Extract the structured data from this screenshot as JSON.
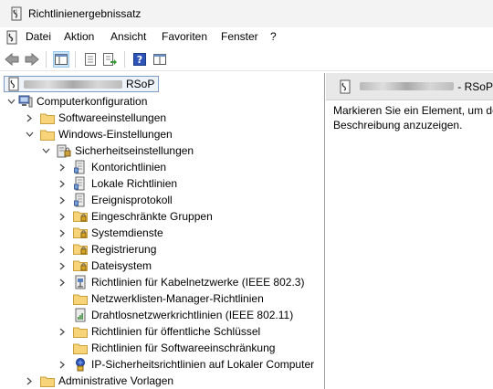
{
  "window": {
    "title": "Richtlinienergebnissatz"
  },
  "menu": {
    "items": [
      "Datei",
      "Aktion",
      "Ansicht",
      "Favoriten",
      "Fenster",
      "?"
    ]
  },
  "tree": {
    "root_suffix": "RSoP",
    "computer_config": "Computerkonfiguration",
    "software_settings": "Softwareeinstellungen",
    "windows_settings": "Windows-Einstellungen",
    "security_settings": "Sicherheitseinstellungen",
    "security_children": [
      "Kontorichtlinien",
      "Lokale Richtlinien",
      "Ereignisprotokoll",
      "Eingeschränkte Gruppen",
      "Systemdienste",
      "Registrierung",
      "Dateisystem",
      "Richtlinien für Kabelnetzwerke (IEEE 802.3)",
      "Netzwerklisten-Manager-Richtlinien",
      "Drahtlosnetzwerkrichtlinien (IEEE 802.11)",
      "Richtlinien für öffentliche Schlüssel",
      "Richtlinien für Softwareeinschränkung",
      "IP-Sicherheitsrichtlinien auf Lokaler Computer"
    ],
    "admin_templates": "Administrative Vorlagen"
  },
  "details": {
    "header_suffix": "- RSoP",
    "description": "Markieren Sie ein Element, um dessen Beschreibung anzuzeigen."
  }
}
